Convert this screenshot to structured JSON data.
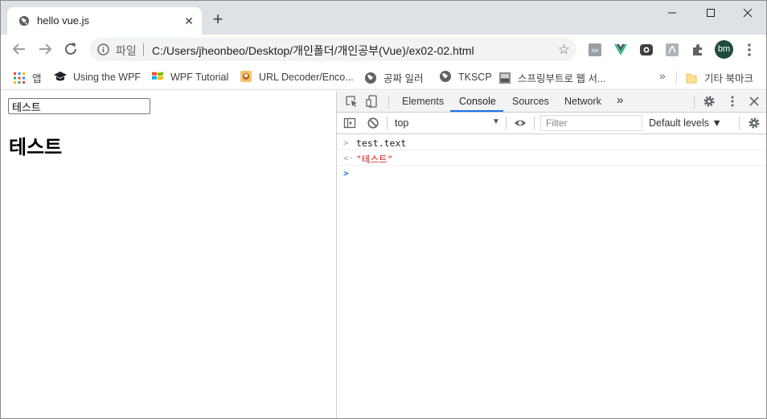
{
  "tab": {
    "title": "hello vue.js",
    "close": "✕",
    "new_tab": "+"
  },
  "omnibox": {
    "scheme": "파일",
    "url": "C:/Users/jheonbeo/Desktop/개인폴더/개인공부(Vue)/ex02-02.html"
  },
  "profile": {
    "initials": "bm"
  },
  "bookmarks": {
    "items": [
      {
        "label": "앱",
        "icon": "apps-grid-icon"
      },
      {
        "label": "Using the WPF",
        "icon": "graduation-cap-icon"
      },
      {
        "label": "WPF Tutorial",
        "icon": "windows-logo-icon"
      },
      {
        "label": "URL Decoder/Enco...",
        "icon": "site-favicon-icon"
      },
      {
        "label": "공짜 일러",
        "icon": "globe-icon"
      },
      {
        "label": "TKSCP",
        "icon": "globe-icon"
      },
      {
        "label": "스프링부트로 웹 서...",
        "icon": "site-favicon-icon"
      }
    ],
    "more": "»",
    "other": "기타 북마크"
  },
  "page": {
    "input_value": "테스트",
    "heading": "테스트"
  },
  "devtools": {
    "tabs": [
      "Elements",
      "Console",
      "Sources",
      "Network"
    ],
    "active_tab": "Console",
    "more_tabs": "»",
    "context": "top",
    "filter_placeholder": "Filter",
    "levels": "Default levels ▼",
    "console": {
      "input": "test.text",
      "output": "\"테스트\""
    }
  },
  "colors": {
    "accent": "#1a73e8",
    "string": "#c41a16",
    "avatar_bg": "#1e4d3a"
  }
}
